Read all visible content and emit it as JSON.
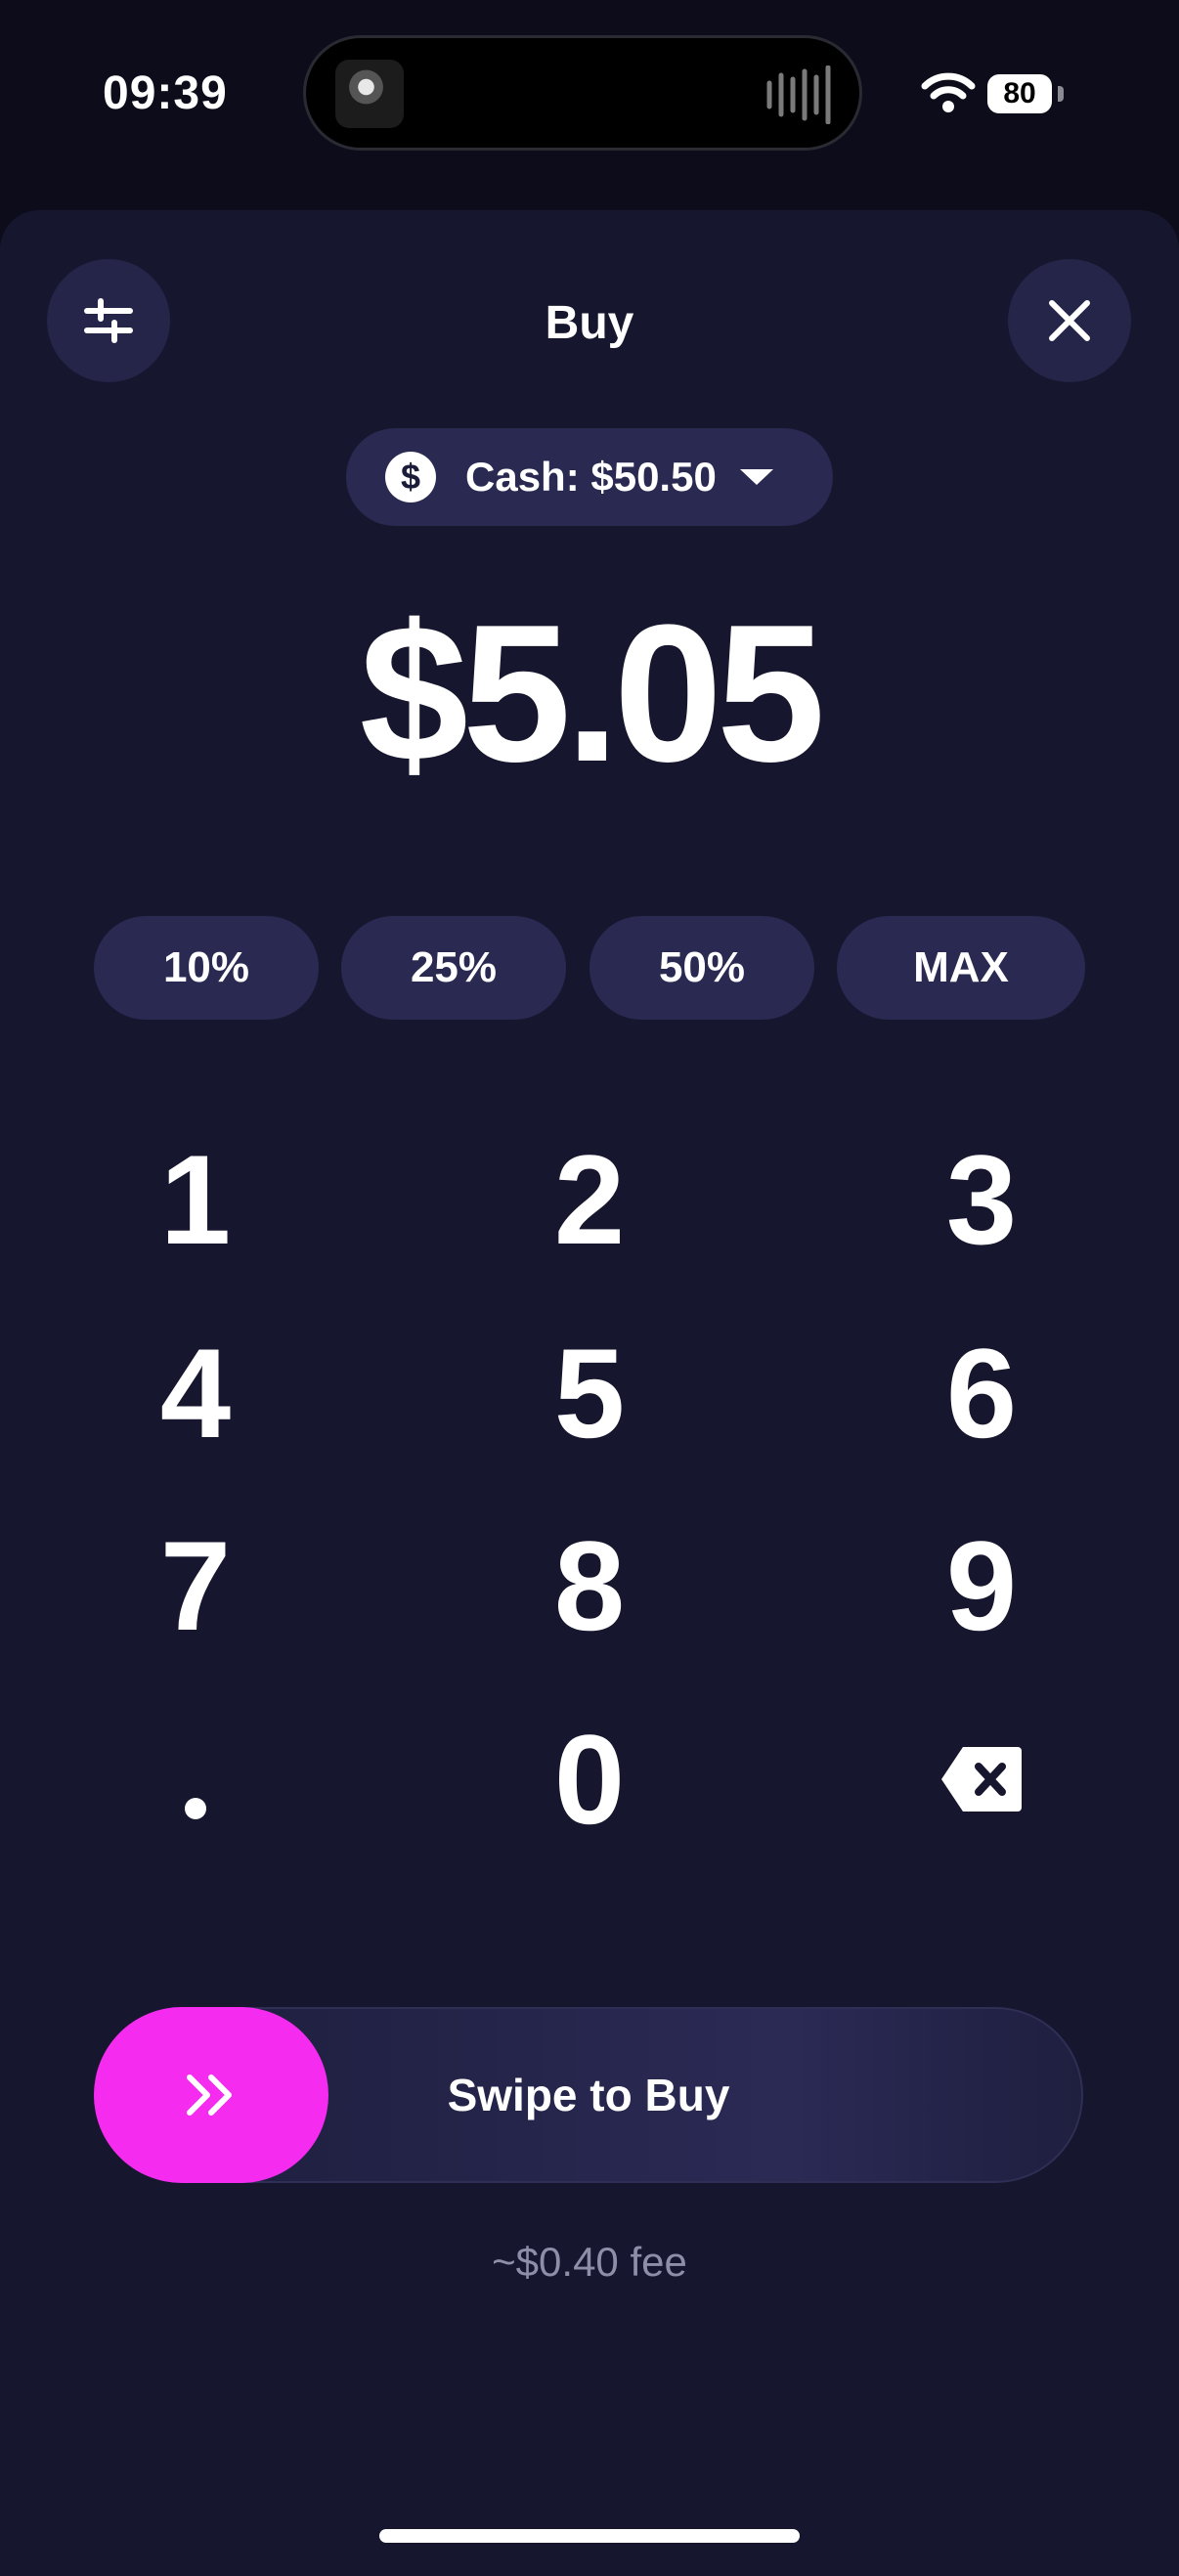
{
  "status_bar": {
    "time": "09:39",
    "battery": "80"
  },
  "sheet": {
    "title": "Buy",
    "cash_selector": {
      "currency_symbol": "$",
      "label": "Cash: $50.50"
    },
    "amount": "$5.05",
    "percent_buttons": [
      "10%",
      "25%",
      "50%",
      "MAX"
    ],
    "keypad": [
      "1",
      "2",
      "3",
      "4",
      "5",
      "6",
      "7",
      "8",
      "9",
      "0"
    ],
    "swipe_label": "Swipe to Buy",
    "fee": "~$0.40 fee"
  },
  "colors": {
    "background": "#0c0c1b",
    "sheet": "#16162e",
    "pill": "#292951",
    "accent": "#f52bf0",
    "muted": "#8e8ea8"
  },
  "icons": [
    "settings-sliders-icon",
    "close-icon",
    "dollar-coin-icon",
    "chevron-down-icon",
    "backspace-icon",
    "double-chevron-right-icon",
    "wifi-icon"
  ]
}
